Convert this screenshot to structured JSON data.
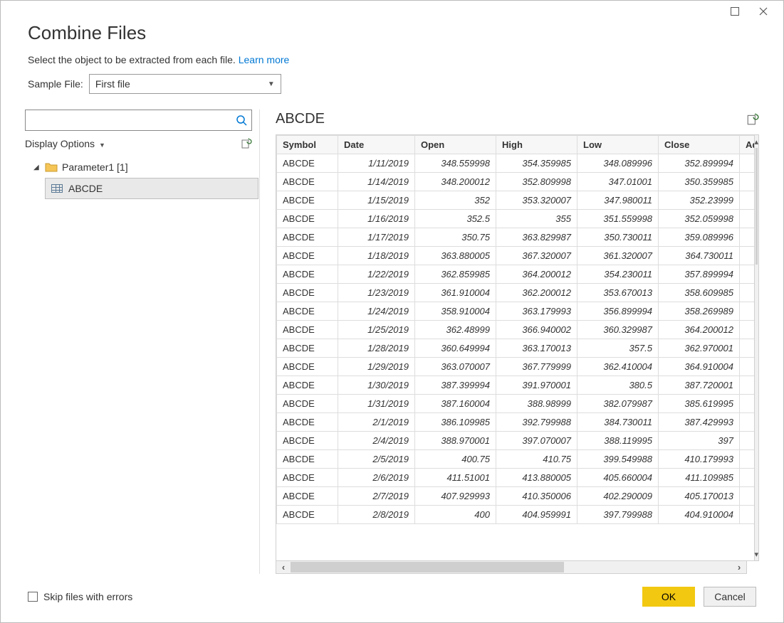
{
  "dialog": {
    "title": "Combine Files",
    "subtitle_text": "Select the object to be extracted from each file.",
    "learn_more": "Learn more",
    "sample_label": "Sample File:",
    "sample_value": "First file"
  },
  "nav": {
    "search_placeholder": "",
    "display_options": "Display Options",
    "root_label": "Parameter1 [1]",
    "child_label": "ABCDE"
  },
  "preview": {
    "title": "ABCDE",
    "columns": [
      "Symbol",
      "Date",
      "Open",
      "High",
      "Low",
      "Close",
      "Ad"
    ],
    "rows": [
      [
        "ABCDE",
        "1/11/2019",
        "348.559998",
        "354.359985",
        "348.089996",
        "352.899994"
      ],
      [
        "ABCDE",
        "1/14/2019",
        "348.200012",
        "352.809998",
        "347.01001",
        "350.359985"
      ],
      [
        "ABCDE",
        "1/15/2019",
        "352",
        "353.320007",
        "347.980011",
        "352.23999"
      ],
      [
        "ABCDE",
        "1/16/2019",
        "352.5",
        "355",
        "351.559998",
        "352.059998"
      ],
      [
        "ABCDE",
        "1/17/2019",
        "350.75",
        "363.829987",
        "350.730011",
        "359.089996"
      ],
      [
        "ABCDE",
        "1/18/2019",
        "363.880005",
        "367.320007",
        "361.320007",
        "364.730011"
      ],
      [
        "ABCDE",
        "1/22/2019",
        "362.859985",
        "364.200012",
        "354.230011",
        "357.899994"
      ],
      [
        "ABCDE",
        "1/23/2019",
        "361.910004",
        "362.200012",
        "353.670013",
        "358.609985"
      ],
      [
        "ABCDE",
        "1/24/2019",
        "358.910004",
        "363.179993",
        "356.899994",
        "358.269989"
      ],
      [
        "ABCDE",
        "1/25/2019",
        "362.48999",
        "366.940002",
        "360.329987",
        "364.200012"
      ],
      [
        "ABCDE",
        "1/28/2019",
        "360.649994",
        "363.170013",
        "357.5",
        "362.970001"
      ],
      [
        "ABCDE",
        "1/29/2019",
        "363.070007",
        "367.779999",
        "362.410004",
        "364.910004"
      ],
      [
        "ABCDE",
        "1/30/2019",
        "387.399994",
        "391.970001",
        "380.5",
        "387.720001"
      ],
      [
        "ABCDE",
        "1/31/2019",
        "387.160004",
        "388.98999",
        "382.079987",
        "385.619995"
      ],
      [
        "ABCDE",
        "2/1/2019",
        "386.109985",
        "392.799988",
        "384.730011",
        "387.429993"
      ],
      [
        "ABCDE",
        "2/4/2019",
        "388.970001",
        "397.070007",
        "388.119995",
        "397"
      ],
      [
        "ABCDE",
        "2/5/2019",
        "400.75",
        "410.75",
        "399.549988",
        "410.179993"
      ],
      [
        "ABCDE",
        "2/6/2019",
        "411.51001",
        "413.880005",
        "405.660004",
        "411.109985"
      ],
      [
        "ABCDE",
        "2/7/2019",
        "407.929993",
        "410.350006",
        "402.290009",
        "405.170013"
      ],
      [
        "ABCDE",
        "2/8/2019",
        "400",
        "404.959991",
        "397.799988",
        "404.910004"
      ]
    ]
  },
  "footer": {
    "skip_label": "Skip files with errors",
    "ok": "OK",
    "cancel": "Cancel"
  }
}
